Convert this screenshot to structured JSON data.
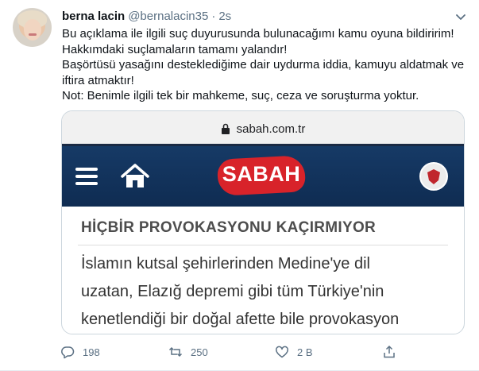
{
  "tweet": {
    "display_name": "berna lacin",
    "handle": "@bernalacin35",
    "separator": "·",
    "timestamp": "2s",
    "text_lines": [
      "Bu açıklama ile ilgili suç duyurusunda bulunacağımı kamu oyuna bildiririm!",
      "Hakkımdaki suçlamaların tamamı yalandır!",
      "Başörtüsü yasağını desteklediğime dair uydurma iddia, kamuyu aldatmak ve",
      "iftira atmaktır!",
      "Not: Benimle ilgili  tek bir mahkeme, suç, ceza ve soruşturma yoktur."
    ]
  },
  "card": {
    "url": "sabah.com.tr",
    "logo_text": "SABAH",
    "headline": "HİÇBİR PROVOKASYONU KAÇIRMIYOR",
    "article_lines": [
      "İslamın kutsal şehirlerinden Medine'ye dil",
      "uzatan, Elazığ depremi gibi tüm Türkiye'nin",
      "kenetlendiği bir doğal afette bile provokasyon"
    ],
    "colors": {
      "navbar": "#163a66",
      "logo": "#d8232a"
    }
  },
  "actions": {
    "reply_count": "198",
    "retweet_count": "250",
    "like_count": "2 B",
    "icons": [
      "reply-icon",
      "retweet-icon",
      "like-icon",
      "share-icon"
    ]
  }
}
